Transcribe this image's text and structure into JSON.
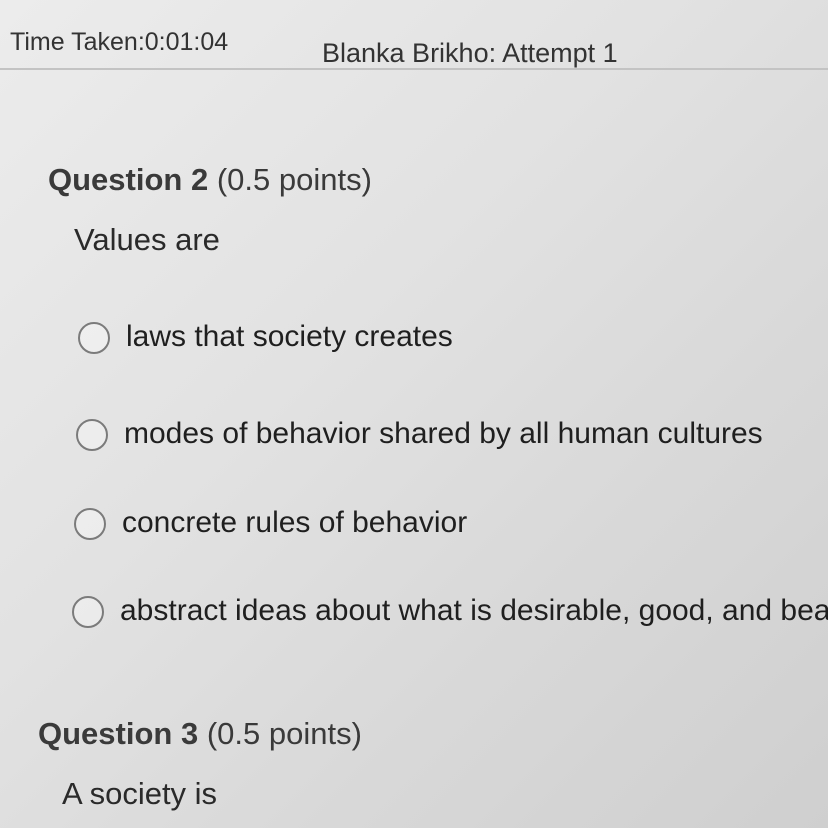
{
  "header": {
    "time_taken": "Time Taken:0:01:04",
    "attempt_title": "Blanka Brikho: Attempt 1"
  },
  "questions": [
    {
      "number_label": "Question 2",
      "points_label": "(0.5 points)",
      "prompt": "Values are",
      "options": [
        {
          "label": "laws that society creates",
          "selected": false
        },
        {
          "label": "modes of behavior shared by all human cultures",
          "selected": false
        },
        {
          "label": "concrete rules of behavior",
          "selected": false
        },
        {
          "label": "abstract ideas about what is desirable, good, and bea",
          "selected": false
        }
      ]
    },
    {
      "number_label": "Question 3",
      "points_label": "(0.5 points)",
      "prompt": "A society is"
    }
  ]
}
